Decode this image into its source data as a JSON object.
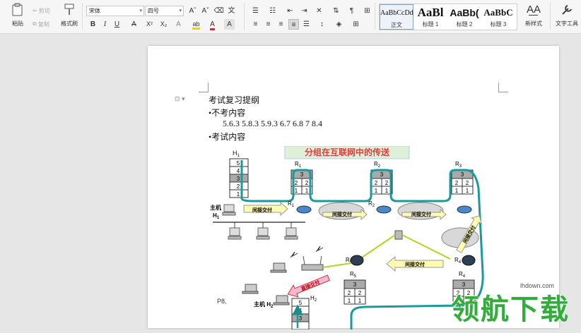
{
  "ribbon": {
    "clipboard": {
      "paste_label": "粘贴",
      "cut_label": "剪切",
      "copy_label": "复制",
      "format_painter_label": "格式刷"
    },
    "font": {
      "family_value": "宋体",
      "size_value": "四号",
      "grow_label": "Aˆ",
      "shrink_label": "Aˇ",
      "bold_label": "B",
      "italic_label": "I",
      "underline_label": "U",
      "strike_label": "A",
      "superscript_label": "X²",
      "subscript_label": "X₂",
      "effects_label": "A",
      "highlight_label": "ab",
      "font_color_label": "A",
      "char_shading_label": "A",
      "highlight_color": "#f5d000",
      "font_color": "#d03030"
    },
    "styles": [
      {
        "preview": "AaBbCcDd",
        "name": "正文"
      },
      {
        "preview": "AaBl",
        "name": "标题 1"
      },
      {
        "preview": "AaBb(",
        "name": "标题 2"
      },
      {
        "preview": "AaBbC",
        "name": "标题 3"
      }
    ],
    "new_style_label": "新样式",
    "text_tools_label": "文字工具"
  },
  "document": {
    "lines": [
      "考试复习提纲",
      "•不考内容",
      "5.6.3 5.8.3 5.9.3    6.7 6.8 7    8.4",
      "•考试内容"
    ],
    "figure": {
      "title": "分组在互联网中的传送",
      "h1": "H",
      "h1_sub": "1",
      "host_label": "主机",
      "host_h1": "H",
      "host_h1_sub": "1",
      "host_h2": "主机 H",
      "host_h2_sub": "2",
      "r_label": "R",
      "r_subs": [
        "1",
        "2",
        "3",
        "4",
        "5"
      ],
      "h2_label": "H",
      "h2_sub": "2",
      "indirect_label": "间接交付",
      "direct_label": "直接交付",
      "stack_a": [
        "5",
        "4",
        "3",
        "2",
        "1"
      ],
      "stack_b": [
        "3",
        "2",
        "1"
      ],
      "footnote": "P8,"
    }
  },
  "watermark": {
    "url": "lhdown.com",
    "brand": "领航下载"
  }
}
